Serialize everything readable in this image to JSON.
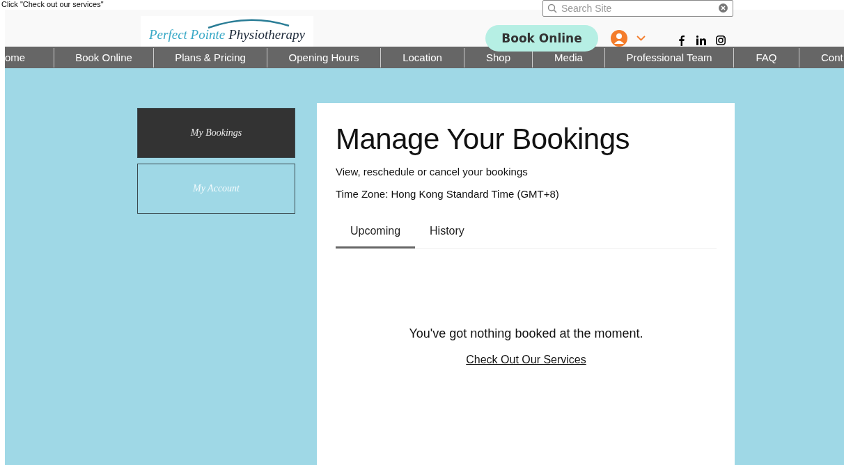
{
  "caption": "Click \"Check out our services\"",
  "header": {
    "logo": {
      "first": "Perfect Pointe",
      "second": "Physiotherapy"
    },
    "search": {
      "placeholder": "Search Site"
    },
    "book_button": "Book Online"
  },
  "nav": [
    {
      "label": "ome",
      "selected": false
    },
    {
      "label": "Book Online",
      "selected": false
    },
    {
      "label": "Plans & Pricing",
      "selected": false
    },
    {
      "label": "Opening Hours",
      "selected": false
    },
    {
      "label": "Location",
      "selected": false
    },
    {
      "label": "Shop",
      "selected": false
    },
    {
      "label": "Media",
      "selected": false
    },
    {
      "label": "Professional Team",
      "selected": false
    },
    {
      "label": "FAQ",
      "selected": false
    },
    {
      "label": "Cont",
      "selected": false
    }
  ],
  "sidebar": [
    {
      "label": "My Bookings",
      "selected": true
    },
    {
      "label": "My Account",
      "selected": false
    }
  ],
  "main": {
    "title": "Manage Your Bookings",
    "subtitle": "View, reschedule or cancel your bookings",
    "timezone": "Time Zone: Hong Kong Standard Time (GMT+8)",
    "tabs": [
      {
        "label": "Upcoming",
        "selected": true
      },
      {
        "label": "History",
        "selected": false
      }
    ],
    "empty_message": "You've got nothing booked at the moment.",
    "link": "Check Out Our Services"
  }
}
